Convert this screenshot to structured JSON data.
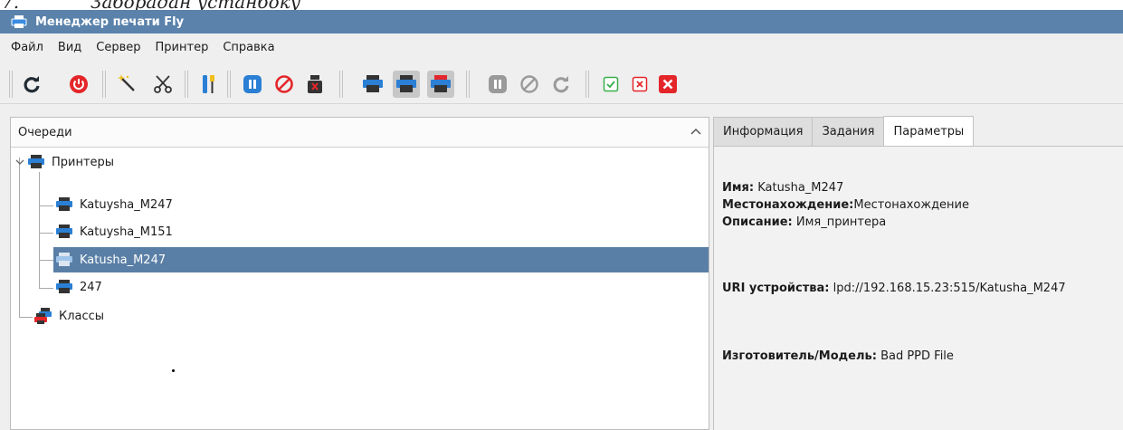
{
  "caption": {
    "number": "7.",
    "text": "Заборадан устанбоку"
  },
  "window": {
    "title": "Менеджер печати Fly"
  },
  "menu": [
    "Файл",
    "Вид",
    "Сервер",
    "Принтер",
    "Справка"
  ],
  "toolbar": {
    "buttons": [
      "refresh-icon",
      "power-icon",
      "wizard-wand-icon",
      "scissors-icon",
      "tools-icon",
      "pause-icon",
      "stop-icon",
      "printer-cancel-icon",
      "printer-icon",
      "printer-icon",
      "printer-icon",
      "pause-icon",
      "stop-icon",
      "refresh-icon",
      "check-icon",
      "cross-icon",
      "cross-icon"
    ]
  },
  "queues": {
    "header": "Очереди",
    "tree": {
      "printers_label": "Принтеры",
      "printers": [
        "Katuysha_M247",
        "Katuysha_M151",
        "Katusha_M247",
        "247"
      ],
      "selected_index": 2,
      "classes_label": "Классы"
    }
  },
  "tabs": [
    "Информация",
    "Задания",
    "Параметры"
  ],
  "active_tab": "Параметры",
  "params": {
    "name_label": "Имя:",
    "name_value": "Katusha_M247",
    "location_label": "Местонахождение:",
    "location_value": "Местонахождение",
    "description_label": "Описание:",
    "description_value": "Имя_принтера",
    "uri_label": "URI устройства:",
    "uri_value": "lpd://192.168.15.23:515/Katusha_M247",
    "model_label": "Изготовитель/Модель:",
    "model_value": "Bad PPD File"
  },
  "colors": {
    "titlebar": "#5a82ab",
    "selection": "#5a7fa6",
    "printer_blue": "#2b7fd4",
    "danger_red": "#e4262a",
    "disabled_gray": "#9a9a9a",
    "check_green": "#39b04a"
  }
}
